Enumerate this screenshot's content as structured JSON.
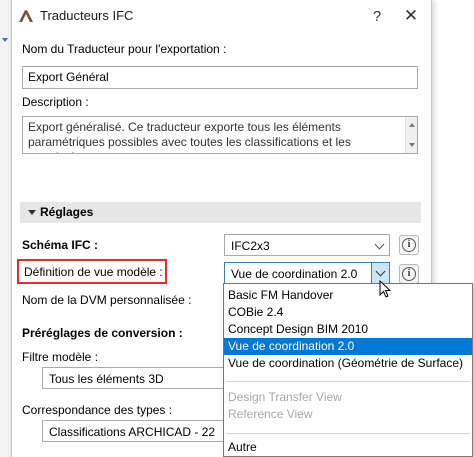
{
  "window": {
    "title": "Traducteurs IFC",
    "help_label": "?",
    "close_label": "✕"
  },
  "translator_name": {
    "label": "Nom du Traducteur pour l'exportation :",
    "value": "Export Général"
  },
  "description": {
    "label": "Description :",
    "value": "Export généralisé. Ce traducteur exporte tous les éléments paramétriques possibles avec toutes les classifications et les proprietés"
  },
  "settings": {
    "header": "Réglages",
    "schema_label": "Schéma IFC :",
    "schema_value": "IFC2x3",
    "mvd_label": "Définition de vue modèle :",
    "mvd_value": "Vue de coordination 2.0",
    "custom_mvd_label": "Nom de la DVM personnalisée :",
    "presets_label": "Préréglages de conversion :",
    "model_filter_label": "Filtre modèle :",
    "model_filter_value": "Tous les éléments 3D",
    "type_mapping_label": "Correspondance des types :",
    "type_mapping_value": "Classifications ARCHICAD - 22",
    "info_icon": "i"
  },
  "dropdown": {
    "items": [
      {
        "label": "Basic FM Handover",
        "state": "normal"
      },
      {
        "label": "COBie 2.4",
        "state": "normal"
      },
      {
        "label": "Concept Design BIM 2010",
        "state": "normal"
      },
      {
        "label": "Vue de coordination 2.0",
        "state": "selected"
      },
      {
        "label": "Vue de coordination (Géométrie de Surface)",
        "state": "normal"
      },
      {
        "label": "Design Transfer View",
        "state": "disabled"
      },
      {
        "label": "Reference View",
        "state": "disabled"
      },
      {
        "label": "Autre",
        "state": "normal"
      }
    ]
  },
  "colors": {
    "selection": "#0078d7",
    "highlight_border": "#e0302c",
    "section_header_bg": "#e6e6e6"
  }
}
